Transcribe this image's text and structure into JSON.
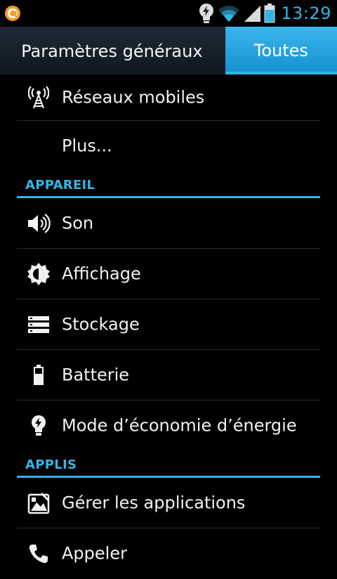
{
  "status_bar": {
    "left_icon": "aviate-notification-icon",
    "icons": [
      "power-saving-bulb-icon",
      "wifi-icon",
      "cell-signal-icon",
      "battery-icon"
    ],
    "time": "13:29",
    "accent_color": "#33b5e5"
  },
  "tabs": [
    {
      "label": "Paramètres généraux",
      "selected": false
    },
    {
      "label": "Toutes",
      "selected": true
    }
  ],
  "list": {
    "network_items": [
      {
        "label": "Réseaux mobiles",
        "icon": "antenna-icon"
      },
      {
        "label": "Plus...",
        "icon": ""
      }
    ],
    "section_device": {
      "header": "APPAREIL",
      "items": [
        {
          "label": "Son",
          "icon": "speaker-icon"
        },
        {
          "label": "Affichage",
          "icon": "brightness-icon"
        },
        {
          "label": "Stockage",
          "icon": "storage-icon"
        },
        {
          "label": "Batterie",
          "icon": "battery-icon"
        },
        {
          "label": "Mode d’économie d’énergie",
          "icon": "lightbulb-icon"
        }
      ]
    },
    "section_apps": {
      "header": "APPLIS",
      "items": [
        {
          "label": "Gérer les applications",
          "icon": "app-manager-icon"
        },
        {
          "label": "Appeler",
          "icon": "phone-icon"
        }
      ]
    }
  }
}
